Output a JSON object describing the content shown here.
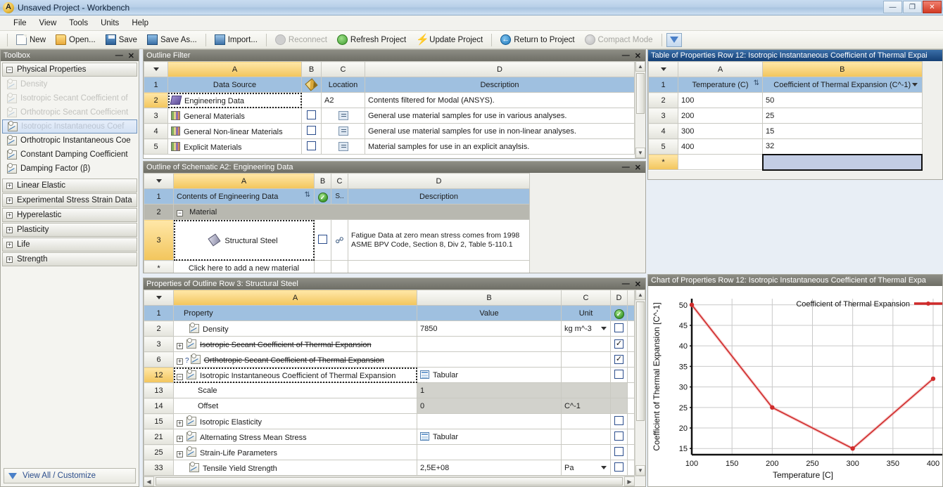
{
  "window": {
    "title": "Unsaved Project - Workbench",
    "app_icon": "ansys-logo-icon",
    "controls": {
      "minimize": "—",
      "restore": "❐",
      "close": "✕"
    }
  },
  "menubar": {
    "items": [
      "File",
      "View",
      "Tools",
      "Units",
      "Help"
    ]
  },
  "toolbar": {
    "buttons": [
      {
        "label": "New",
        "icon": "new-document-icon",
        "disabled": false
      },
      {
        "label": "Open...",
        "icon": "open-folder-icon",
        "disabled": false
      },
      {
        "label": "Save",
        "icon": "save-disk-icon",
        "disabled": false
      },
      {
        "label": "Save As...",
        "icon": "save-as-icon",
        "disabled": false
      },
      {
        "label": "Import...",
        "icon": "import-icon",
        "disabled": false
      },
      {
        "label": "Reconnect",
        "icon": "reconnect-icon",
        "disabled": true
      },
      {
        "label": "Refresh Project",
        "icon": "refresh-icon",
        "disabled": false
      },
      {
        "label": "Update Project",
        "icon": "lightning-update-icon",
        "disabled": false
      },
      {
        "label": "Return to Project",
        "icon": "return-arrow-icon",
        "disabled": false
      },
      {
        "label": "Compact Mode",
        "icon": "compact-mode-icon",
        "disabled": true
      }
    ],
    "filter_button": "filter-icon"
  },
  "toolbox": {
    "title": "Toolbox",
    "minimize": "—",
    "close": "✕",
    "groups": [
      {
        "label": "Physical Properties",
        "expander": "−",
        "expanded": true,
        "items": [
          {
            "label": "Density",
            "state": "dimmed"
          },
          {
            "label": "Isotropic Secant Coefficient of",
            "state": "dimmed"
          },
          {
            "label": "Orthotropic Secant Coefficient",
            "state": "dimmed"
          },
          {
            "label": "Isotropic Instantaneous Coef",
            "state": "selected"
          },
          {
            "label": "Orthotropic Instantaneous Coe",
            "state": "normal"
          },
          {
            "label": "Constant Damping Coefficient",
            "state": "normal"
          },
          {
            "label": "Damping Factor (β)",
            "state": "normal"
          }
        ]
      },
      {
        "label": "Linear Elastic",
        "expander": "+",
        "expanded": false,
        "items": []
      },
      {
        "label": "Experimental Stress Strain Data",
        "expander": "+",
        "expanded": false,
        "items": []
      },
      {
        "label": "Hyperelastic",
        "expander": "+",
        "expanded": false,
        "items": []
      },
      {
        "label": "Plasticity",
        "expander": "+",
        "expanded": false,
        "items": []
      },
      {
        "label": "Life",
        "expander": "+",
        "expanded": false,
        "items": []
      },
      {
        "label": "Strength",
        "expander": "+",
        "expanded": false,
        "items": []
      }
    ],
    "footer_link": "View All / Customize"
  },
  "outline_filter": {
    "title": "Outline Filter",
    "minimize": "—",
    "close": "✕",
    "columns": [
      "A",
      "B",
      "C",
      "D"
    ],
    "active_column": "A",
    "header_row": {
      "num": "1",
      "a": "Data Source",
      "b": "pencil-icon",
      "c": "Location",
      "d": "Description"
    },
    "rows": [
      {
        "num": "2",
        "icon": "engineering-data-icon",
        "a": "Engineering Data",
        "b": "",
        "c": "A2",
        "d": "Contents filtered for Modal (ANSYS).",
        "selected": true,
        "active": true
      },
      {
        "num": "3",
        "icon": "material-book-icon",
        "a": "General Materials",
        "b": "checkbox",
        "c": "xls-icon",
        "d": "General use material samples for use in various analyses.",
        "selected": false,
        "active": false
      },
      {
        "num": "4",
        "icon": "material-book-icon",
        "a": "General Non-linear Materials",
        "b": "checkbox",
        "c": "xls-icon",
        "d": "General use material samples for use in non-linear analyses.",
        "selected": false,
        "active": false
      },
      {
        "num": "5",
        "icon": "material-book-icon",
        "a": "Explicit Materials",
        "b": "checkbox",
        "c": "xls-icon",
        "d": "Material samples for use in an explicit anaylsis.",
        "selected": false,
        "active": false
      }
    ]
  },
  "outline_engineering": {
    "title": "Outline of Schematic A2: Engineering Data",
    "minimize": "—",
    "close": "✕",
    "columns": [
      "A",
      "B",
      "C",
      "D"
    ],
    "active_column": "A",
    "header_row": {
      "num": "1",
      "a": "Contents of Engineering Data",
      "a_icon": "sort-icon",
      "b": "green-check-icon",
      "c": "S..",
      "d": "Description"
    },
    "group_row": {
      "num": "2",
      "expander": "−",
      "label": "Material"
    },
    "material_row": {
      "num": "3",
      "icon": "material-tag-icon",
      "a": "Structural Steel",
      "b": "checkbox",
      "c": "link-icon",
      "d": "Fatigue Data at zero mean stress comes from 1998 ASME BPV Code, Section 8, Div 2, Table 5-110.1",
      "selected": true,
      "active": true
    },
    "add_row": {
      "num": "*",
      "placeholder": "Click here to add a new material"
    }
  },
  "properties": {
    "title": "Properties of Outline Row 3: Structural Steel",
    "minimize": "—",
    "close": "✕",
    "columns": [
      "A",
      "B",
      "C",
      "D"
    ],
    "active_column": "A",
    "header_row": {
      "num": "1",
      "a": "Property",
      "b": "Value",
      "c": "Unit",
      "d": "green-check-icon"
    },
    "rows": [
      {
        "num": "2",
        "indent": 0,
        "expander": "",
        "icon": "property-curve-icon",
        "a": "Density",
        "b": "7850",
        "c": "kg m^-3",
        "c_dropdown": true,
        "d": "unchecked",
        "strike": false,
        "selected": false,
        "valuegray": false
      },
      {
        "num": "3",
        "indent": 0,
        "expander": "+",
        "icon": "property-table-icon",
        "a": "Isotropic Secant Coefficient of Thermal Expansion",
        "b": "",
        "c": "",
        "c_dropdown": false,
        "d": "checked",
        "strike": true,
        "selected": false,
        "valuegray": false
      },
      {
        "num": "6",
        "indent": 0,
        "expander": "+",
        "icon": "property-table-icon",
        "a": "Orthotropic Secant Coefficient of Thermal Expansion",
        "b": "",
        "c": "",
        "c_dropdown": false,
        "d": "checked",
        "strike": true,
        "selected": false,
        "valuegray": false,
        "help": "?"
      },
      {
        "num": "12",
        "indent": 0,
        "expander": "−",
        "icon": "property-table-icon",
        "a": "Isotropic Instantaneous Coefficient of Thermal Expansion",
        "b": "Tabular",
        "b_icon": "tabular-icon",
        "c": "",
        "c_dropdown": false,
        "d": "unchecked",
        "strike": false,
        "selected": true,
        "active": true,
        "valuegray": false
      },
      {
        "num": "13",
        "indent": 1,
        "expander": "",
        "icon": "",
        "a": "Scale",
        "b": "1",
        "c": "",
        "c_dropdown": false,
        "d": "unchecked",
        "strike": false,
        "selected": false,
        "valuegray": true
      },
      {
        "num": "14",
        "indent": 1,
        "expander": "",
        "icon": "",
        "a": "Offset",
        "b": "0",
        "c": "C^-1",
        "c_dropdown": false,
        "d": "unchecked",
        "strike": false,
        "selected": false,
        "valuegray": true
      },
      {
        "num": "15",
        "indent": 0,
        "expander": "+",
        "icon": "property-curve-icon",
        "a": "Isotropic Elasticity",
        "b": "",
        "c": "",
        "c_dropdown": false,
        "d": "unchecked",
        "strike": false,
        "selected": false,
        "valuegray": false
      },
      {
        "num": "21",
        "indent": 0,
        "expander": "+",
        "icon": "property-curve-icon",
        "a": "Alternating Stress Mean Stress",
        "b": "Tabular",
        "b_icon": "tabular-icon",
        "c": "",
        "c_dropdown": false,
        "d": "unchecked",
        "strike": false,
        "selected": false,
        "valuegray": false
      },
      {
        "num": "25",
        "indent": 0,
        "expander": "+",
        "icon": "property-curve-icon",
        "a": "Strain-Life Parameters",
        "b": "",
        "c": "",
        "c_dropdown": false,
        "d": "unchecked",
        "strike": false,
        "selected": false,
        "valuegray": false
      },
      {
        "num": "33",
        "indent": 0,
        "expander": "",
        "icon": "property-curve-icon",
        "a": "Tensile Yield Strength",
        "b": "2,5E+08",
        "c": "Pa",
        "c_dropdown": true,
        "d": "unchecked",
        "strike": false,
        "selected": false,
        "valuegray": false
      }
    ]
  },
  "table_of_properties": {
    "title": "Table of Properties Row 12: Isotropic Instantaneous Coefficient of Thermal Expai",
    "columns": [
      "A",
      "B"
    ],
    "active_column": "B",
    "header_row": {
      "num": "1",
      "a": "Temperature (C)",
      "a_icon": "sort-icon",
      "b": "Coefficient of Thermal Expansion (C^-1)",
      "b_icon": "dropdown-icon"
    },
    "rows": [
      {
        "num": "2",
        "a": "100",
        "b": "50"
      },
      {
        "num": "3",
        "a": "200",
        "b": "25"
      },
      {
        "num": "4",
        "a": "300",
        "b": "15"
      },
      {
        "num": "5",
        "a": "400",
        "b": "32"
      }
    ],
    "new_row": {
      "num": "*",
      "a": "",
      "b": ""
    }
  },
  "chart": {
    "title": "Chart of Properties Row 12: Isotropic Instantaneous Coefficient of Thermal Expa"
  },
  "chart_data": {
    "type": "line",
    "title": "",
    "xlabel": "Temperature  [C]",
    "ylabel": "Coefficient of Thermal Expansion  [C^-1]",
    "x": [
      100,
      200,
      300,
      400
    ],
    "series": [
      {
        "name": "Coefficient of Thermal Expansion",
        "values": [
          50,
          25,
          15,
          32
        ],
        "color": "#cf2b2b"
      }
    ],
    "xticks": [
      100,
      150,
      200,
      250,
      300,
      350,
      400
    ],
    "yticks": [
      15,
      20,
      25,
      30,
      35,
      40,
      45,
      50
    ],
    "xlim": [
      90,
      400
    ],
    "ylim": [
      13.5,
      51.5
    ],
    "grid": true,
    "legend_position": "top-right",
    "clipped_right": true
  },
  "colors": {
    "accent_orange": "#f2c55c",
    "header_blue": "#9fc0e0",
    "title_blue": "#143f74",
    "series_red": "#cf2b2b"
  }
}
